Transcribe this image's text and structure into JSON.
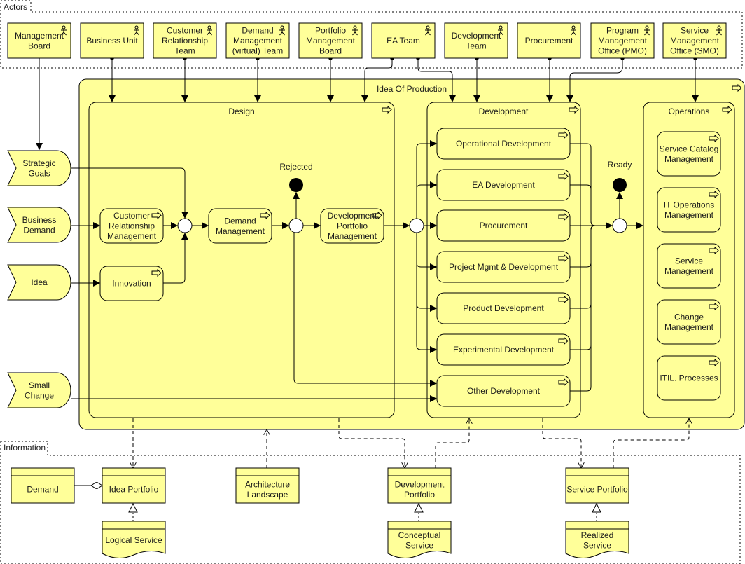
{
  "groups": {
    "actors": "Actors",
    "information": "Information"
  },
  "actors": [
    {
      "id": "management-board",
      "label": [
        "Management",
        "Board"
      ]
    },
    {
      "id": "business-unit",
      "label": [
        "Business Unit"
      ]
    },
    {
      "id": "customer-relationship-team",
      "label": [
        "Customer",
        "Relationship",
        "Team"
      ]
    },
    {
      "id": "demand-management-team",
      "label": [
        "Demand",
        "Management",
        "(virtual) Team"
      ]
    },
    {
      "id": "portfolio-management-board",
      "label": [
        "Portfolio",
        "Management",
        "Board"
      ]
    },
    {
      "id": "ea-team",
      "label": [
        "EA Team"
      ]
    },
    {
      "id": "development-team",
      "label": [
        "Development",
        "Team"
      ]
    },
    {
      "id": "procurement",
      "label": [
        "Procurement"
      ]
    },
    {
      "id": "pmo",
      "label": [
        "Program",
        "Management",
        "Office (PMO)"
      ]
    },
    {
      "id": "smo",
      "label": [
        "Service",
        "Management",
        "Office (SMO)"
      ]
    }
  ],
  "events": [
    {
      "id": "strategic-goals",
      "label": [
        "Strategic",
        "Goals"
      ]
    },
    {
      "id": "business-demand",
      "label": [
        "Business",
        "Demand"
      ]
    },
    {
      "id": "idea",
      "label": [
        "Idea"
      ]
    },
    {
      "id": "small-change",
      "label": [
        "Small",
        "Change"
      ]
    }
  ],
  "production": {
    "title": "Idea Of Production",
    "design": {
      "title": "Design",
      "processes": [
        {
          "id": "customer-relationship-management",
          "label": [
            "Customer",
            "Relationship",
            "Management"
          ]
        },
        {
          "id": "innovation",
          "label": [
            "Innovation"
          ]
        },
        {
          "id": "demand-management",
          "label": [
            "Demand",
            "Management"
          ]
        },
        {
          "id": "development-portfolio-management",
          "label": [
            "Development",
            "Portfolio",
            "Management"
          ]
        }
      ],
      "rejected_label": "Rejected"
    },
    "development": {
      "title": "Development",
      "processes": [
        {
          "id": "operational-development",
          "label": [
            "Operational Development"
          ]
        },
        {
          "id": "ea-development",
          "label": [
            "EA Development"
          ]
        },
        {
          "id": "procurement-process",
          "label": [
            "Procurement"
          ]
        },
        {
          "id": "project-mgmt-development",
          "label": [
            "Project Mgmt & Development"
          ]
        },
        {
          "id": "product-development",
          "label": [
            "Product Development"
          ]
        },
        {
          "id": "experimental-development",
          "label": [
            "Experimental Development"
          ]
        },
        {
          "id": "other-development",
          "label": [
            "Other Development"
          ]
        }
      ]
    },
    "ready_label": "Ready",
    "operations": {
      "title": "Operations",
      "processes": [
        {
          "id": "service-catalog-management",
          "label": [
            "Service Catalog",
            "Management"
          ]
        },
        {
          "id": "it-operations-management",
          "label": [
            "IT Operations",
            "Management"
          ]
        },
        {
          "id": "service-management",
          "label": [
            "Service",
            "Management"
          ]
        },
        {
          "id": "change-management",
          "label": [
            "Change",
            "Management"
          ]
        },
        {
          "id": "itil-processes",
          "label": [
            "ITIL. Processes"
          ]
        }
      ]
    }
  },
  "information": {
    "objects": [
      {
        "id": "demand",
        "label": [
          "Demand"
        ]
      },
      {
        "id": "idea-portfolio",
        "label": [
          "Idea Portfolio"
        ]
      },
      {
        "id": "architecture-landscape",
        "label": [
          "Architecture",
          "Landscape"
        ]
      },
      {
        "id": "development-portfolio",
        "label": [
          "Development",
          "Portfolio"
        ]
      },
      {
        "id": "service-portfolio",
        "label": [
          "Service Portfolio"
        ]
      }
    ],
    "representations": [
      {
        "id": "logical-service",
        "label": [
          "Logical Service"
        ]
      },
      {
        "id": "conceptual-service",
        "label": [
          "Conceptual",
          "Service"
        ]
      },
      {
        "id": "realized-service",
        "label": [
          "Realized",
          "Service"
        ]
      }
    ]
  },
  "colors": {
    "fill": "#ffff99",
    "stroke": "#000000",
    "text": "#1a1a1a"
  }
}
